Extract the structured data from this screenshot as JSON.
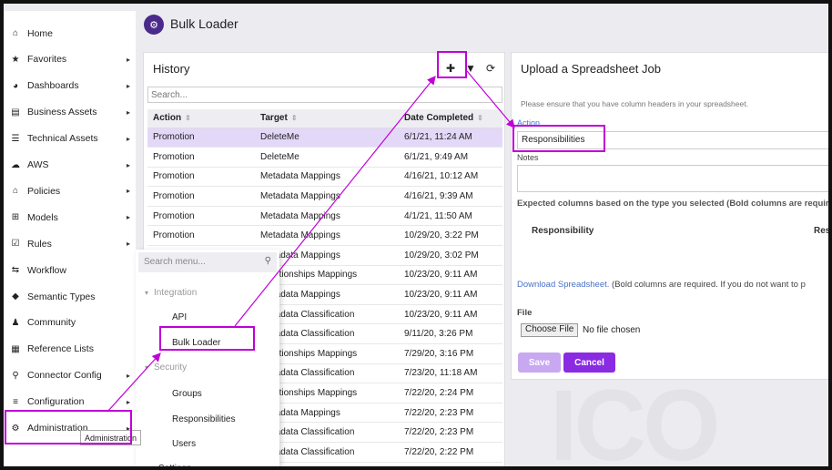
{
  "header": {
    "title": "Bulk Loader"
  },
  "sidebar": {
    "items": [
      {
        "label": "Home",
        "icon": "home-icon",
        "glyph": "⌂",
        "chev": ""
      },
      {
        "label": "Favorites",
        "icon": "star-icon",
        "glyph": "★",
        "chev": "▸"
      },
      {
        "label": "Dashboards",
        "icon": "dashboard-icon",
        "glyph": "◕",
        "chev": "▸"
      },
      {
        "label": "Business Assets",
        "icon": "book-icon",
        "glyph": "▤",
        "chev": "▸"
      },
      {
        "label": "Technical Assets",
        "icon": "database-icon",
        "glyph": "☰",
        "chev": "▸"
      },
      {
        "label": "AWS",
        "icon": "cloud-icon",
        "glyph": "☁",
        "chev": "▸"
      },
      {
        "label": "Policies",
        "icon": "institution-icon",
        "glyph": "⌂",
        "chev": "▸"
      },
      {
        "label": "Models",
        "icon": "sitemap-icon",
        "glyph": "⊞",
        "chev": "▸"
      },
      {
        "label": "Rules",
        "icon": "check-square-icon",
        "glyph": "☑",
        "chev": "▸"
      },
      {
        "label": "Workflow",
        "icon": "workflow-icon",
        "glyph": "⇆",
        "chev": ""
      },
      {
        "label": "Semantic Types",
        "icon": "tag-icon",
        "glyph": "◆",
        "chev": ""
      },
      {
        "label": "Community",
        "icon": "users-icon",
        "glyph": "♟",
        "chev": ""
      },
      {
        "label": "Reference Lists",
        "icon": "list-icon",
        "glyph": "▦",
        "chev": ""
      },
      {
        "label": "Connector Config",
        "icon": "plug-icon",
        "glyph": "⚲",
        "chev": "▸"
      },
      {
        "label": "Configuration",
        "icon": "sliders-icon",
        "glyph": "≡",
        "chev": "▸"
      },
      {
        "label": "Administration",
        "icon": "gear-icon",
        "glyph": "⚙",
        "chev": "▸"
      }
    ]
  },
  "tooltip": "Administration",
  "submenu": {
    "search_placeholder": "Search menu...",
    "groups": [
      {
        "label": "Integration",
        "items": [
          "API",
          "Bulk Loader"
        ]
      },
      {
        "label": "Security",
        "items": [
          "Groups",
          "Responsibilities",
          "Users"
        ]
      }
    ],
    "trailing": "Settings"
  },
  "history": {
    "title": "History",
    "search_placeholder": "Search...",
    "columns": [
      "Action",
      "Target",
      "Date Completed"
    ],
    "rows": [
      [
        "Promotion",
        "DeleteMe",
        "6/1/21, 11:24 AM"
      ],
      [
        "Promotion",
        "DeleteMe",
        "6/1/21, 9:49 AM"
      ],
      [
        "Promotion",
        "Metadata Mappings",
        "4/16/21, 10:12 AM"
      ],
      [
        "Promotion",
        "Metadata Mappings",
        "4/16/21, 9:39 AM"
      ],
      [
        "Promotion",
        "Metadata Mappings",
        "4/1/21, 11:50 AM"
      ],
      [
        "Promotion",
        "Metadata Mappings",
        "10/29/20, 3:22 PM"
      ],
      [
        "",
        "Metadata Mappings",
        "10/29/20, 3:02 PM"
      ],
      [
        "",
        "Relationships Mappings",
        "10/23/20, 9:11 AM"
      ],
      [
        "",
        "Metadata Mappings",
        "10/23/20, 9:11 AM"
      ],
      [
        "",
        "Metadata Classification",
        "10/23/20, 9:11 AM"
      ],
      [
        "",
        "Metadata Classification",
        "9/11/20, 3:26 PM"
      ],
      [
        "",
        "Relationships Mappings",
        "7/29/20, 3:16 PM"
      ],
      [
        "",
        "Metadata Classification",
        "7/23/20, 11:18 AM"
      ],
      [
        "",
        "Relationships Mappings",
        "7/22/20, 2:24 PM"
      ],
      [
        "",
        "Metadata Mappings",
        "7/22/20, 2:23 PM"
      ],
      [
        "",
        "Metadata Classification",
        "7/22/20, 2:23 PM"
      ],
      [
        "",
        "Metadata Classification",
        "7/22/20, 2:22 PM"
      ]
    ]
  },
  "upload": {
    "title": "Upload a Spreadsheet Job",
    "note": "Please ensure that you have column headers in your spreadsheet.",
    "action_label": "Action",
    "action_value": "Responsibilities",
    "notes_label": "Notes",
    "expected": "Expected columns based on the type you selected (Bold columns are requir",
    "col1": "Responsibility",
    "col2": "Res",
    "download_link": "Download Spreadsheet.",
    "download_rest": " (Bold columns are required. If you do not want to p",
    "file_label": "File",
    "choose_file": "Choose File",
    "no_file": "No file chosen",
    "save": "Save",
    "cancel": "Cancel"
  },
  "colors": {
    "accent": "#8a2be2",
    "highlight": "#c000d8",
    "selected_row": "#e4d8f8"
  }
}
